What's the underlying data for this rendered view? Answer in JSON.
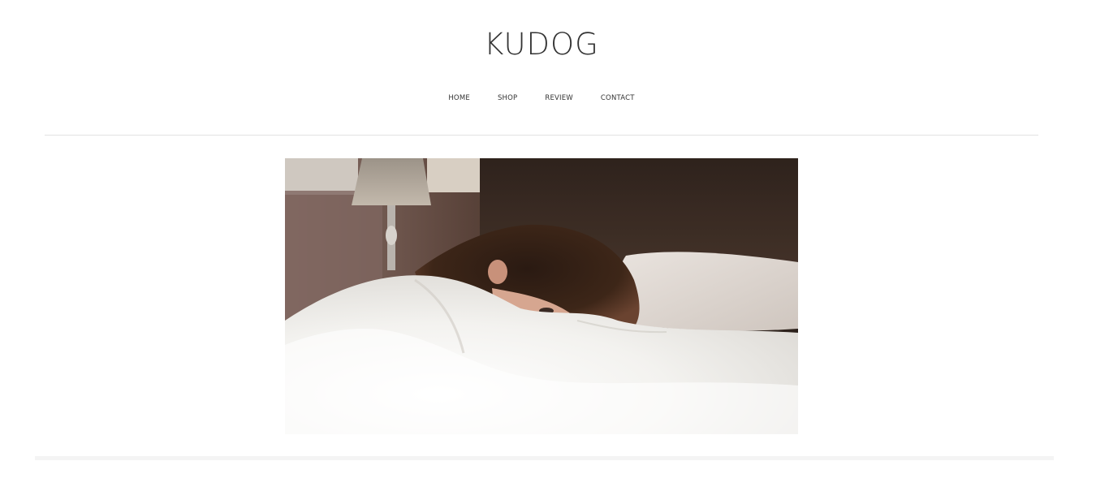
{
  "site": {
    "title": "KUDOG"
  },
  "nav": {
    "items": [
      {
        "label": "HOME"
      },
      {
        "label": "SHOP"
      },
      {
        "label": "REVIEW"
      },
      {
        "label": "CONTACT"
      }
    ]
  },
  "hero": {
    "image_alt": "woman lying in bed under white sheets"
  }
}
